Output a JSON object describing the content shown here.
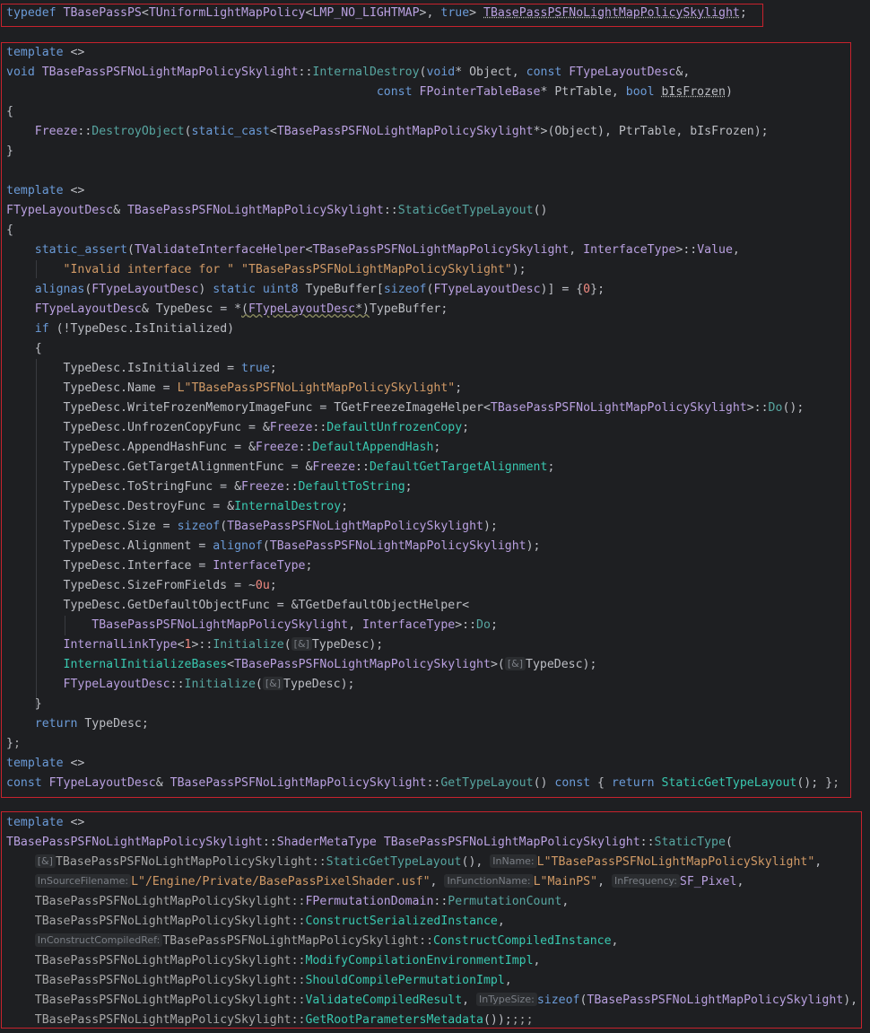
{
  "blocks": [
    {
      "lines": [
        [
          [
            "kw",
            "typedef "
          ],
          [
            "ty",
            "TBasePassPS"
          ],
          [
            "p",
            "<"
          ],
          [
            "ty",
            "TUniformLightMapPolicy"
          ],
          [
            "p",
            "<"
          ],
          [
            "mc",
            "LMP_NO_LIGHTMAP"
          ],
          [
            "p",
            "&gt;, "
          ],
          [
            "kw",
            "true"
          ],
          [
            "p",
            "&gt; "
          ],
          [
            "tyd",
            "TBasePassPSFNoLightMapPolicySkylight"
          ],
          [
            "p",
            ";"
          ]
        ]
      ]
    },
    {
      "lines": [
        [
          [
            "kw",
            "template"
          ],
          [
            "p",
            " &lt;&gt;"
          ]
        ],
        [
          [
            "kw",
            "void "
          ],
          [
            "ty",
            "TBasePassPSFNoLightMapPolicySkylight"
          ],
          [
            "p",
            "::"
          ],
          [
            "fn",
            "InternalDestroy"
          ],
          [
            "p",
            "("
          ],
          [
            "kw",
            "void"
          ],
          [
            "p",
            "* Object, "
          ],
          [
            "kw",
            "const "
          ],
          [
            "ty",
            "FTypeLayoutDesc"
          ],
          [
            "p",
            "&amp;,"
          ]
        ],
        [
          [
            "p",
            "                                                    "
          ],
          [
            "kw",
            "const "
          ],
          [
            "ty",
            "FPointerTableBase"
          ],
          [
            "p",
            "* PtrTable, "
          ],
          [
            "kw",
            "bool "
          ],
          [
            "pd",
            "bIsFrozen"
          ],
          [
            "p",
            ")"
          ]
        ],
        [
          [
            "p",
            "{"
          ]
        ],
        [
          [
            "p",
            "    "
          ],
          [
            "ty",
            "Freeze"
          ],
          [
            "p",
            "::"
          ],
          [
            "fn",
            "DestroyObject"
          ],
          [
            "p",
            "("
          ],
          [
            "kw",
            "static_cast"
          ],
          [
            "p",
            "&lt;"
          ],
          [
            "ty",
            "TBasePassPSFNoLightMapPolicySkylight"
          ],
          [
            "p",
            "*&gt;(Object), PtrTable, bIsFrozen);"
          ]
        ],
        [
          [
            "p",
            "}"
          ]
        ],
        [],
        [
          [
            "kw",
            "template"
          ],
          [
            "p",
            " &lt;&gt;"
          ]
        ],
        [
          [
            "ty",
            "FTypeLayoutDesc"
          ],
          [
            "p",
            "&amp; "
          ],
          [
            "ty",
            "TBasePassPSFNoLightMapPolicySkylight"
          ],
          [
            "p",
            "::"
          ],
          [
            "fn",
            "StaticGetTypeLayout"
          ],
          [
            "p",
            "()"
          ]
        ],
        [
          [
            "p",
            "{"
          ]
        ],
        [
          [
            "p",
            "    "
          ],
          [
            "kw",
            "static_assert"
          ],
          [
            "p",
            "("
          ],
          [
            "ty",
            "TValidateInterfaceHelper"
          ],
          [
            "p",
            "&lt;"
          ],
          [
            "ty",
            "TBasePassPSFNoLightMapPolicySkylight"
          ],
          [
            "p",
            ", "
          ],
          [
            "ty",
            "InterfaceType"
          ],
          [
            "p",
            "&gt;::"
          ],
          [
            "ty",
            "Value"
          ],
          [
            "p",
            ","
          ]
        ],
        [
          [
            "p",
            "        "
          ],
          [
            "st",
            "\"Invalid interface for \" \"TBasePassPSFNoLightMapPolicySkylight\""
          ],
          [
            "p",
            ");"
          ]
        ],
        [
          [
            "p",
            "    "
          ],
          [
            "kw",
            "alignas"
          ],
          [
            "p",
            "("
          ],
          [
            "ty",
            "FTypeLayoutDesc"
          ],
          [
            "p",
            ") "
          ],
          [
            "kw",
            "static "
          ],
          [
            "kw",
            "uint8 "
          ],
          [
            "p",
            "TypeBuffer["
          ],
          [
            "kw",
            "sizeof"
          ],
          [
            "p",
            "("
          ],
          [
            "ty",
            "FTypeLayoutDesc"
          ],
          [
            "p",
            ")] = {"
          ],
          [
            "nm",
            "0"
          ],
          [
            "p",
            "};"
          ]
        ],
        [
          [
            "p",
            "    "
          ],
          [
            "ty",
            "FTypeLayoutDesc"
          ],
          [
            "p",
            "&amp; TypeDesc = *"
          ],
          [
            "pw",
            "("
          ],
          [
            "tyw",
            "FTypeLayoutDesc"
          ],
          [
            "pw",
            "*)"
          ],
          [
            "p",
            "TypeBuffer;"
          ]
        ],
        [
          [
            "p",
            "    "
          ],
          [
            "kw",
            "if "
          ],
          [
            "p",
            "(!TypeDesc.IsInitialized)"
          ]
        ],
        [
          [
            "p",
            "    {"
          ]
        ],
        [
          [
            "p",
            "        TypeDesc.IsInitialized = "
          ],
          [
            "kw",
            "true"
          ],
          [
            "p",
            ";"
          ]
        ],
        [
          [
            "p",
            "        TypeDesc.Name = "
          ],
          [
            "st",
            "L\"TBasePassPSFNoLightMapPolicySkylight\""
          ],
          [
            "p",
            ";"
          ]
        ],
        [
          [
            "p",
            "        TypeDesc.WriteFrozenMemoryImageFunc = TGetFreezeImageHelper&lt;"
          ],
          [
            "ty",
            "TBasePassPSFNoLightMapPolicySkylight"
          ],
          [
            "p",
            "&gt;::"
          ],
          [
            "fn",
            "Do"
          ],
          [
            "p",
            "();"
          ]
        ],
        [
          [
            "p",
            "        TypeDesc.UnfrozenCopyFunc = &amp;"
          ],
          [
            "ty",
            "Freeze"
          ],
          [
            "p",
            "::"
          ],
          [
            "gf",
            "DefaultUnfrozenCopy"
          ],
          [
            "p",
            ";"
          ]
        ],
        [
          [
            "p",
            "        TypeDesc.AppendHashFunc = &amp;"
          ],
          [
            "ty",
            "Freeze"
          ],
          [
            "p",
            "::"
          ],
          [
            "gf",
            "DefaultAppendHash"
          ],
          [
            "p",
            ";"
          ]
        ],
        [
          [
            "p",
            "        TypeDesc.GetTargetAlignmentFunc = &amp;"
          ],
          [
            "ty",
            "Freeze"
          ],
          [
            "p",
            "::"
          ],
          [
            "gf",
            "DefaultGetTargetAlignment"
          ],
          [
            "p",
            ";"
          ]
        ],
        [
          [
            "p",
            "        TypeDesc.ToStringFunc = &amp;"
          ],
          [
            "ty",
            "Freeze"
          ],
          [
            "p",
            "::"
          ],
          [
            "gf",
            "DefaultToString"
          ],
          [
            "p",
            ";"
          ]
        ],
        [
          [
            "p",
            "        TypeDesc.DestroyFunc = &amp;"
          ],
          [
            "gf",
            "InternalDestroy"
          ],
          [
            "p",
            ";"
          ]
        ],
        [
          [
            "p",
            "        TypeDesc.Size = "
          ],
          [
            "kw",
            "sizeof"
          ],
          [
            "p",
            "("
          ],
          [
            "ty",
            "TBasePassPSFNoLightMapPolicySkylight"
          ],
          [
            "p",
            ");"
          ]
        ],
        [
          [
            "p",
            "        TypeDesc.Alignment = "
          ],
          [
            "kw",
            "alignof"
          ],
          [
            "p",
            "("
          ],
          [
            "ty",
            "TBasePassPSFNoLightMapPolicySkylight"
          ],
          [
            "p",
            ");"
          ]
        ],
        [
          [
            "p",
            "        TypeDesc.Interface = "
          ],
          [
            "ty",
            "InterfaceType"
          ],
          [
            "p",
            ";"
          ]
        ],
        [
          [
            "p",
            "        TypeDesc.SizeFromFields = ~"
          ],
          [
            "nm",
            "0u"
          ],
          [
            "p",
            ";"
          ]
        ],
        [
          [
            "p",
            "        TypeDesc.GetDefaultObjectFunc = &amp;TGetDefaultObjectHelper&lt;"
          ]
        ],
        [
          [
            "p",
            "            "
          ],
          [
            "ty",
            "TBasePassPSFNoLightMapPolicySkylight"
          ],
          [
            "p",
            ", "
          ],
          [
            "ty",
            "InterfaceType"
          ],
          [
            "p",
            "&gt;::"
          ],
          [
            "fn",
            "Do"
          ],
          [
            "p",
            ";"
          ]
        ],
        [
          [
            "p",
            "        "
          ],
          [
            "ty",
            "InternalLinkType"
          ],
          [
            "p",
            "&lt;"
          ],
          [
            "nm",
            "1"
          ],
          [
            "p",
            "&gt;::"
          ],
          [
            "fn",
            "Initialize"
          ],
          [
            "p",
            "("
          ],
          [
            "h",
            "[&]"
          ],
          [
            "p",
            "TypeDesc);"
          ]
        ],
        [
          [
            "p",
            "        "
          ],
          [
            "gf",
            "InternalInitializeBases"
          ],
          [
            "p",
            "&lt;"
          ],
          [
            "ty",
            "TBasePassPSFNoLightMapPolicySkylight"
          ],
          [
            "p",
            "&gt;("
          ],
          [
            "h",
            "[&]"
          ],
          [
            "p",
            "TypeDesc);"
          ]
        ],
        [
          [
            "p",
            "        "
          ],
          [
            "ty",
            "FTypeLayoutDesc"
          ],
          [
            "p",
            "::"
          ],
          [
            "fn",
            "Initialize"
          ],
          [
            "p",
            "("
          ],
          [
            "h",
            "[&]"
          ],
          [
            "p",
            "TypeDesc);"
          ]
        ],
        [
          [
            "p",
            "    }"
          ]
        ],
        [
          [
            "p",
            "    "
          ],
          [
            "kw",
            "return "
          ],
          [
            "p",
            "TypeDesc;"
          ]
        ],
        [
          [
            "p",
            "}"
          ],
          [
            "mu",
            ";"
          ]
        ],
        [
          [
            "kw",
            "template"
          ],
          [
            "p",
            " &lt;&gt;"
          ]
        ],
        [
          [
            "kw",
            "const "
          ],
          [
            "ty",
            "FTypeLayoutDesc"
          ],
          [
            "p",
            "&amp; "
          ],
          [
            "ty",
            "TBasePassPSFNoLightMapPolicySkylight"
          ],
          [
            "p",
            "::"
          ],
          [
            "fn",
            "GetTypeLayout"
          ],
          [
            "p",
            "() "
          ],
          [
            "kw",
            "const "
          ],
          [
            "p",
            "{ "
          ],
          [
            "kw",
            "return "
          ],
          [
            "gf",
            "StaticGetTypeLayout"
          ],
          [
            "p",
            "(); }"
          ],
          [
            "mu",
            ";"
          ]
        ]
      ]
    },
    {
      "lines": [
        [
          [
            "kw",
            "template"
          ],
          [
            "p",
            " &lt;&gt;"
          ]
        ],
        [
          [
            "ty",
            "TBasePassPSFNoLightMapPolicySkylight"
          ],
          [
            "p",
            "::"
          ],
          [
            "ty",
            "ShaderMetaType "
          ],
          [
            "ty",
            "TBasePassPSFNoLightMapPolicySkylight"
          ],
          [
            "p",
            "::"
          ],
          [
            "fn",
            "StaticType"
          ],
          [
            "p",
            "("
          ]
        ],
        [
          [
            "p",
            "    "
          ],
          [
            "h",
            "[&]"
          ],
          [
            "mu",
            "TBasePassPSFNoLightMapPolicySkylight::"
          ],
          [
            "fn",
            "StaticGetTypeLayout"
          ],
          [
            "p",
            "(), "
          ],
          [
            "h",
            "InName:"
          ],
          [
            "st",
            "L\"TBasePassPSFNoLightMapPolicySkylight\""
          ],
          [
            "p",
            ","
          ]
        ],
        [
          [
            "p",
            "    "
          ],
          [
            "h",
            "InSourceFilename:"
          ],
          [
            "st",
            "L\"/Engine/Private/BasePassPixelShader.usf\""
          ],
          [
            "p",
            ", "
          ],
          [
            "h",
            "InFunctionName:"
          ],
          [
            "st",
            "L\"MainPS\""
          ],
          [
            "p",
            ", "
          ],
          [
            "h",
            "InFrequency:"
          ],
          [
            "mc",
            "SF_Pixel"
          ],
          [
            "p",
            ","
          ]
        ],
        [
          [
            "p",
            "    "
          ],
          [
            "mu",
            "TBasePassPSFNoLightMapPolicySkylight::"
          ],
          [
            "ty",
            "FPermutationDomain"
          ],
          [
            "p",
            "::"
          ],
          [
            "fn",
            "PermutationCount"
          ],
          [
            "p",
            ","
          ]
        ],
        [
          [
            "p",
            "    "
          ],
          [
            "mu",
            "TBasePassPSFNoLightMapPolicySkylight::"
          ],
          [
            "gf",
            "ConstructSerializedInstance"
          ],
          [
            "p",
            ","
          ]
        ],
        [
          [
            "p",
            "    "
          ],
          [
            "h",
            "InConstructCompiledRef:"
          ],
          [
            "mu",
            "TBasePassPSFNoLightMapPolicySkylight::"
          ],
          [
            "gf",
            "ConstructCompiledInstance"
          ],
          [
            "p",
            ","
          ]
        ],
        [
          [
            "p",
            "    "
          ],
          [
            "mu",
            "TBasePassPSFNoLightMapPolicySkylight::"
          ],
          [
            "gf",
            "ModifyCompilationEnvironmentImpl"
          ],
          [
            "p",
            ","
          ]
        ],
        [
          [
            "p",
            "    "
          ],
          [
            "mu",
            "TBasePassPSFNoLightMapPolicySkylight::"
          ],
          [
            "gf",
            "ShouldCompilePermutationImpl"
          ],
          [
            "p",
            ","
          ]
        ],
        [
          [
            "p",
            "    "
          ],
          [
            "mu",
            "TBasePassPSFNoLightMapPolicySkylight::"
          ],
          [
            "gf",
            "ValidateCompiledResult"
          ],
          [
            "p",
            ", "
          ],
          [
            "h",
            "InTypeSize:"
          ],
          [
            "kw",
            "sizeof"
          ],
          [
            "p",
            "("
          ],
          [
            "ty",
            "TBasePassPSFNoLightMapPolicySkylight"
          ],
          [
            "p",
            "),"
          ]
        ],
        [
          [
            "p",
            "    "
          ],
          [
            "mu",
            "TBasePassPSFNoLightMapPolicySkylight::"
          ],
          [
            "gf",
            "GetRootParametersMetadata"
          ],
          [
            "p",
            "());"
          ],
          [
            "mu",
            ";;;"
          ]
        ]
      ]
    }
  ]
}
